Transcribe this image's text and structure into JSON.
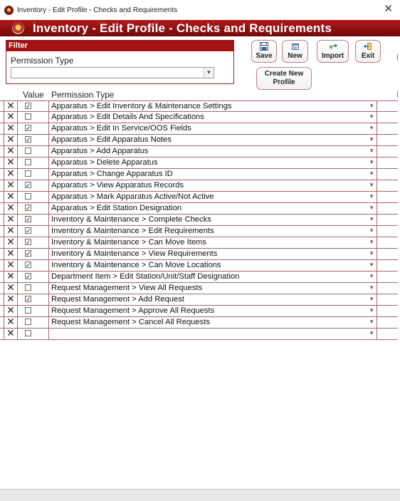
{
  "window": {
    "title": "Inventory - Edit Profile - Checks and Requirements",
    "close_glyph": "✕"
  },
  "banner": {
    "title": "Inventory - Edit Profile - Checks and Requirements"
  },
  "filter": {
    "header": "Filter",
    "label": "Permission Type",
    "selected_value": ""
  },
  "toolbar": {
    "save_label": "Save",
    "new_label": "New",
    "import_label": "Import",
    "exit_label": "Exit",
    "create_profile_label": "Create New Profile"
  },
  "grid": {
    "columns": {
      "value": "Value",
      "permission_type": "Permission Type"
    },
    "rows": [
      {
        "checked": true,
        "permission": "Apparatus > Edit Inventory & Maintenance Settings"
      },
      {
        "checked": false,
        "permission": "Apparatus > Edit Details And Specifications"
      },
      {
        "checked": true,
        "permission": "Apparatus > Edit In Service/OOS Fields"
      },
      {
        "checked": true,
        "permission": "Apparatus > Edit Apparatus Notes"
      },
      {
        "checked": false,
        "permission": "Apparatus > Add Apparatus"
      },
      {
        "checked": false,
        "permission": "Apparatus > Delete Apparatus"
      },
      {
        "checked": false,
        "permission": "Apparatus > Change Apparatus ID"
      },
      {
        "checked": true,
        "permission": "Apparatus > View Apparatus Records"
      },
      {
        "checked": false,
        "permission": "Apparatus > Mark Apparatus Active/Not Active"
      },
      {
        "checked": true,
        "permission": "Apparatus > Edit Station Designation"
      },
      {
        "checked": true,
        "permission": "Inventory & Maintenance > Complete Checks"
      },
      {
        "checked": true,
        "permission": "Inventory & Maintenance > Edit Requirements"
      },
      {
        "checked": true,
        "permission": "Inventory & Maintenance > Can Move Items"
      },
      {
        "checked": true,
        "permission": "Inventory & Maintenance > View Requirements"
      },
      {
        "checked": true,
        "permission": "Inventory & Maintenance > Can Move Locations"
      },
      {
        "checked": true,
        "permission": "Department Item > Edit Station/Unit/Staff Designation"
      },
      {
        "checked": false,
        "permission": "Request Management > View All Requests"
      },
      {
        "checked": true,
        "permission": "Request Management > Add Request"
      },
      {
        "checked": false,
        "permission": "Request Management > Approve All Requests"
      },
      {
        "checked": false,
        "permission": "Request Management > Cancel All Requests"
      },
      {
        "checked": false,
        "permission": ""
      }
    ]
  },
  "icons": {
    "app": "fire-badge-icon",
    "save": "floppy-disk-icon",
    "new": "new-document-icon",
    "import": "import-arrow-icon",
    "exit": "exit-door-icon",
    "delete": "red-x-icon",
    "dropdown": "chevron-down-icon"
  },
  "colors": {
    "banner": "#9e1414",
    "accent_border": "#a66666",
    "delete_x": "#2a2a2a"
  }
}
